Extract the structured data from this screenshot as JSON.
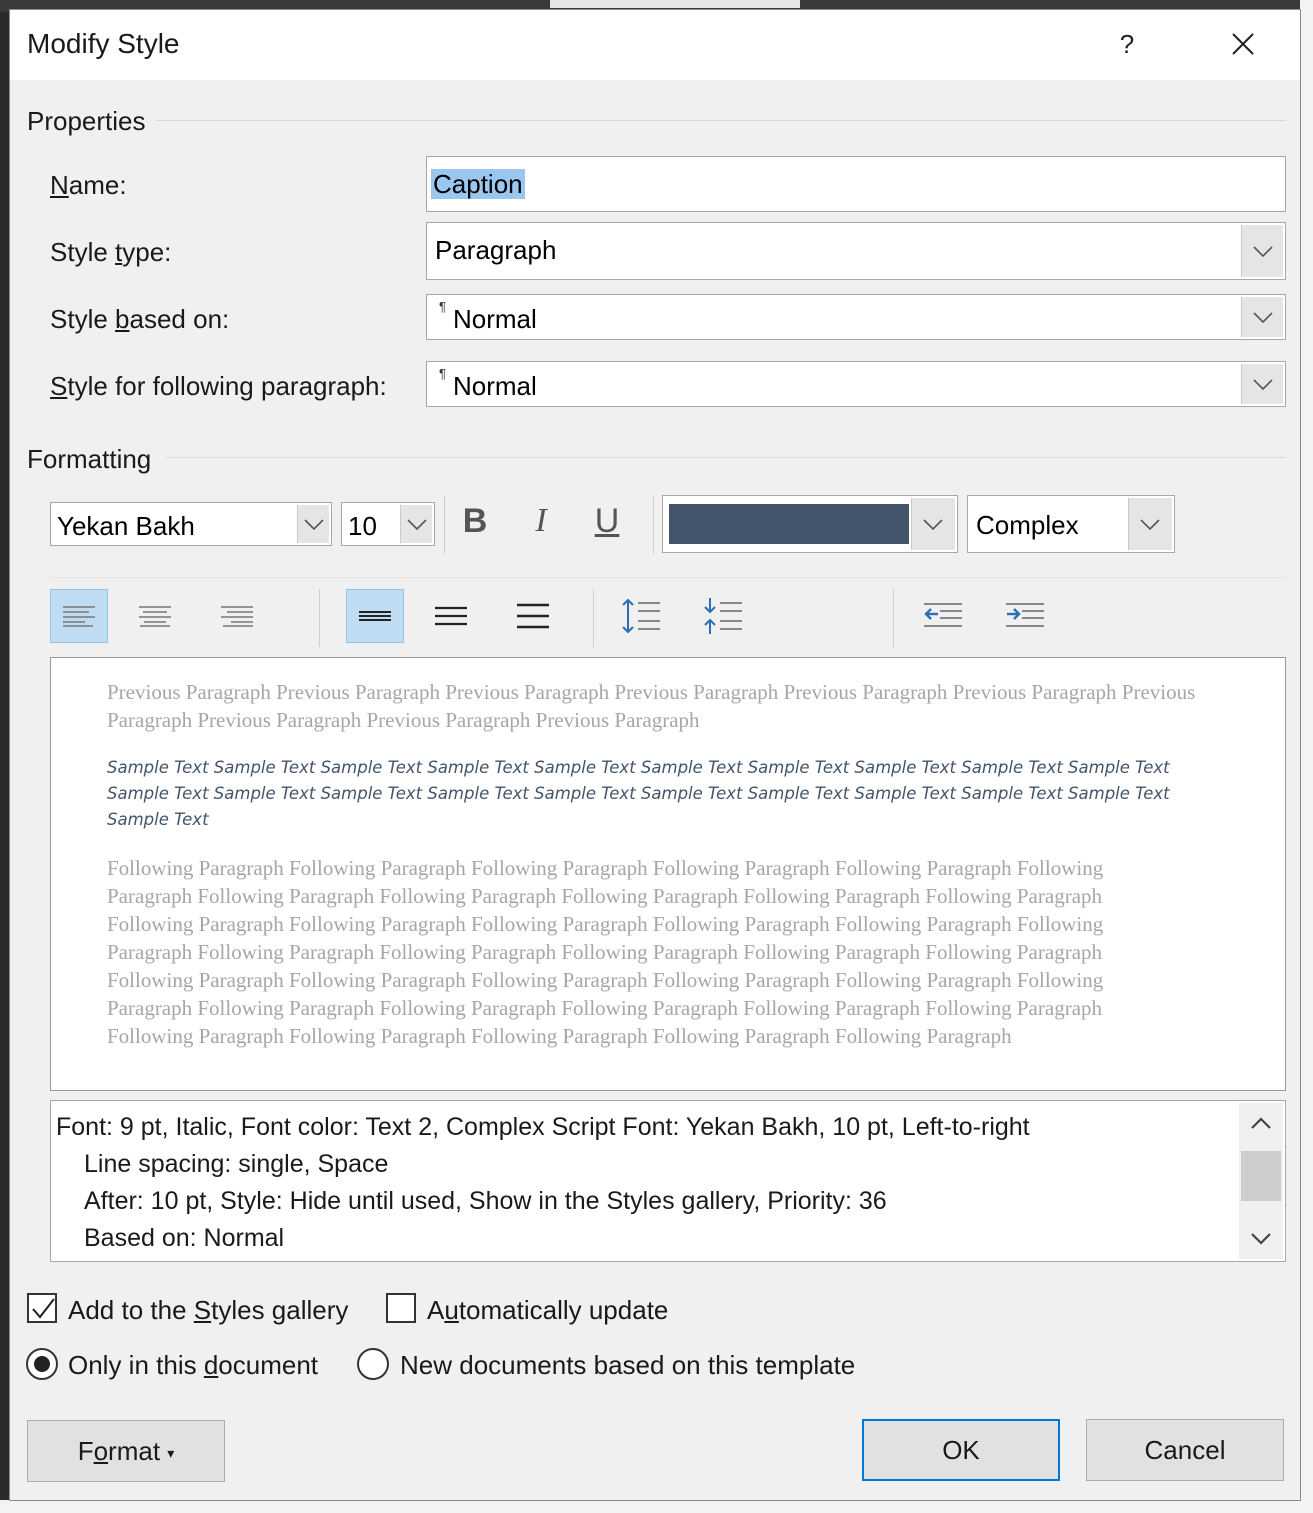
{
  "dialog": {
    "title": "Modify Style",
    "help_label": "?"
  },
  "properties": {
    "section_label": "Properties",
    "name_label_pre": "",
    "name_label_u": "N",
    "name_label_post": "ame:",
    "name_value": "Caption",
    "style_type_label_pre": "Style ",
    "style_type_label_u": "t",
    "style_type_label_post": "ype:",
    "style_type_value": "Paragraph",
    "based_on_label_pre": "Style ",
    "based_on_label_u": "b",
    "based_on_label_post": "ased on:",
    "based_on_value": "Normal",
    "following_label_pre": "",
    "following_label_u": "S",
    "following_label_post": "tyle for following paragraph:",
    "following_value": "Normal",
    "pilcrow": "¶"
  },
  "formatting": {
    "section_label": "Formatting",
    "font_name": "Yekan Bakh",
    "font_size": "10",
    "bold_label": "B",
    "italic_label": "I",
    "underline_label": "U",
    "font_color": "#44546a",
    "script_value": "Complex"
  },
  "preview": {
    "previous_paragraph": "Previous Paragraph Previous Paragraph Previous Paragraph Previous Paragraph Previous Paragraph Previous Paragraph Previous Paragraph Previous Paragraph Previous Paragraph Previous Paragraph",
    "sample_text": "Sample Text Sample Text Sample Text Sample Text Sample Text Sample Text Sample Text Sample Text Sample Text Sample Text Sample Text Sample Text Sample Text Sample Text Sample Text Sample Text Sample Text Sample Text Sample Text Sample Text Sample Text",
    "following_paragraph": "Following Paragraph Following Paragraph Following Paragraph Following Paragraph Following Paragraph Following Paragraph Following Paragraph Following Paragraph Following Paragraph Following Paragraph Following Paragraph Following Paragraph Following Paragraph Following Paragraph Following Paragraph Following Paragraph Following Paragraph Following Paragraph Following Paragraph Following Paragraph Following Paragraph Following Paragraph Following Paragraph Following Paragraph Following Paragraph Following Paragraph Following Paragraph Following Paragraph Following Paragraph Following Paragraph Following Paragraph Following Paragraph Following Paragraph Following Paragraph Following Paragraph Following Paragraph Following Paragraph Following Paragraph"
  },
  "description": {
    "line1": "Font: 9 pt, Italic, Font color: Text 2, Complex Script Font: Yekan Bakh, 10 pt, Left-to-right",
    "line2": "Line spacing:  single, Space",
    "line3": "After:  10 pt, Style: Hide until used, Show in the Styles gallery, Priority: 36",
    "line4": "Based on: Normal"
  },
  "options": {
    "add_gallery_pre": "Add to the ",
    "add_gallery_u": "S",
    "add_gallery_post": "tyles gallery",
    "add_gallery_checked": true,
    "auto_update_pre": "A",
    "auto_update_u": "u",
    "auto_update_post": "tomatically update",
    "auto_update_checked": false,
    "only_doc_pre": "Only in this ",
    "only_doc_u": "d",
    "only_doc_post": "ocument",
    "new_docs_label": "New documents based on this template"
  },
  "buttons": {
    "format_pre": "F",
    "format_u": "o",
    "format_post": "rmat",
    "format_caret": "▾",
    "ok": "OK",
    "cancel": "Cancel"
  },
  "colors": {
    "accent": "#0078d7",
    "selection": "#99c7ef",
    "active_tool": "#c0dcf3"
  }
}
